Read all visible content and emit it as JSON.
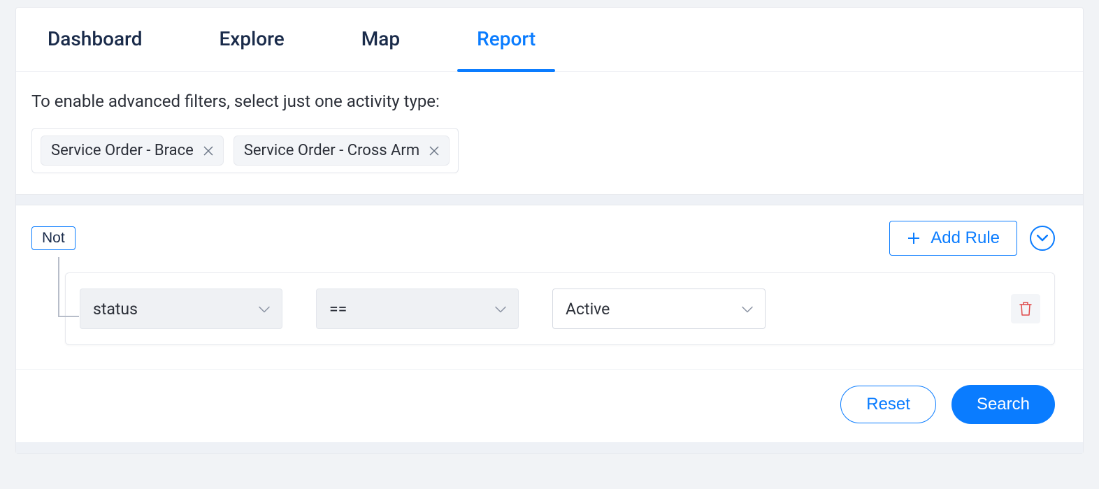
{
  "tabs": {
    "dashboard": "Dashboard",
    "explore": "Explore",
    "map": "Map",
    "report": "Report"
  },
  "hint": "To enable advanced filters, select just one activity type:",
  "chips": [
    {
      "label": "Service Order - Brace"
    },
    {
      "label": "Service Order - Cross Arm"
    }
  ],
  "builder": {
    "not_label": "Not",
    "add_rule_label": "Add Rule",
    "rule": {
      "field": "status",
      "operator": "==",
      "value": "Active"
    }
  },
  "footer": {
    "reset": "Reset",
    "search": "Search"
  }
}
